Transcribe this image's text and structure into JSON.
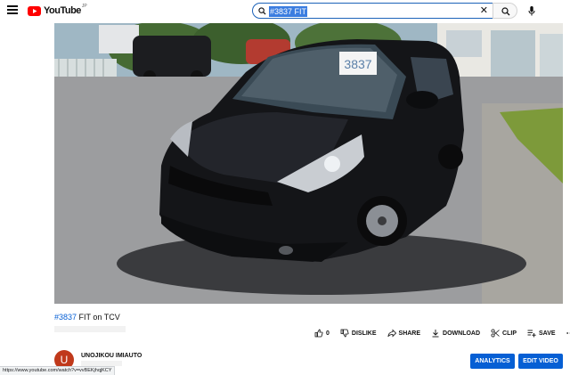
{
  "header": {
    "logo_text": "YouTube",
    "logo_country": "JP",
    "search_value": "#3837 FIT",
    "clear_label": "✕"
  },
  "video": {
    "plate_text": "3837"
  },
  "title": {
    "tag": "#3837",
    "text": " FIT on TCV"
  },
  "actions": {
    "like_count": "0",
    "dislike_label": "DISLIKE",
    "share_label": "SHARE",
    "download_label": "DOWNLOAD",
    "clip_label": "CLIP",
    "save_label": "SAVE",
    "more_label": "⋯"
  },
  "channel": {
    "avatar_letter": "U",
    "name": "UNOJIKOU IMIAUTO"
  },
  "buttons": {
    "analytics": "ANALYTICS",
    "edit_video": "EDIT VIDEO"
  },
  "status_bar": {
    "url": "https://www.youtube.com/watch?v=vvBEKjhqjKCY"
  },
  "colors": {
    "accent": "#065fd4",
    "brand_red": "#ff0000",
    "avatar": "#c0391b"
  }
}
